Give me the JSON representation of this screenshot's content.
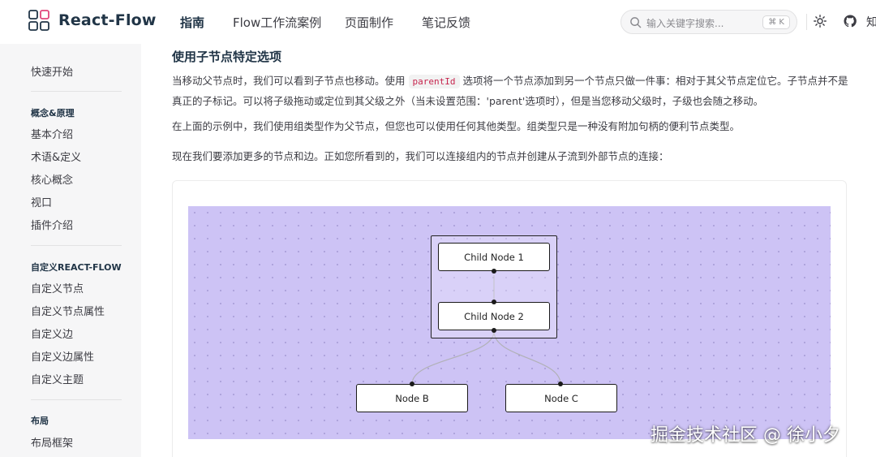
{
  "brand": {
    "name": "React-Flow"
  },
  "nav": {
    "items": [
      {
        "label": "指南",
        "active": true
      },
      {
        "label": "Flow工作流案例",
        "active": false
      },
      {
        "label": "页面制作",
        "active": false
      },
      {
        "label": "笔记反馈",
        "active": false
      }
    ],
    "extra_label": "知"
  },
  "search": {
    "placeholder": "输入关键字搜索...",
    "shortcut": "⌘ K"
  },
  "sidebar": {
    "top_item": "快速开始",
    "sections": [
      {
        "title": "概念&原理",
        "items": [
          "基本介绍",
          "术语&定义",
          "核心概念",
          "视口",
          "插件介绍"
        ]
      },
      {
        "title": "自定义REACT-FLOW",
        "items": [
          "自定义节点",
          "自定义节点属性",
          "自定义边",
          "自定义边属性",
          "自定义主题"
        ]
      },
      {
        "title": "布局",
        "items": [
          "布局框架"
        ]
      }
    ]
  },
  "main": {
    "heading": "使用子节点特定选项",
    "p1_before": "当移动父节点时，我们可以看到子节点也移动。使用",
    "p1_code": "parentId",
    "p1_after": "选项将一个节点添加到另一个节点只做一件事：相对于其父节点定位它。子节点并不是真正的子标记。可以将子级拖动或定位到其父级之外（当未设置范围：'parent'选项时），但是当您移动父级时，子级也会随之移动。",
    "p2": "在上面的示例中，我们使用组类型作为父节点，但您也可以使用任何其他类型。组类型只是一种没有附加句柄的便利节点类型。",
    "p3": "现在我们要添加更多的节点和边。正如您所看到的，我们可以连接组内的节点并创建从子流到外部节点的连接："
  },
  "flow": {
    "background_color": "#cdc3f5",
    "nodes": [
      {
        "label": "Child Node 1"
      },
      {
        "label": "Child Node 2"
      },
      {
        "label": "Node B"
      },
      {
        "label": "Node C"
      }
    ]
  },
  "watermark": "掘金技术社区 @ 徐小夕"
}
